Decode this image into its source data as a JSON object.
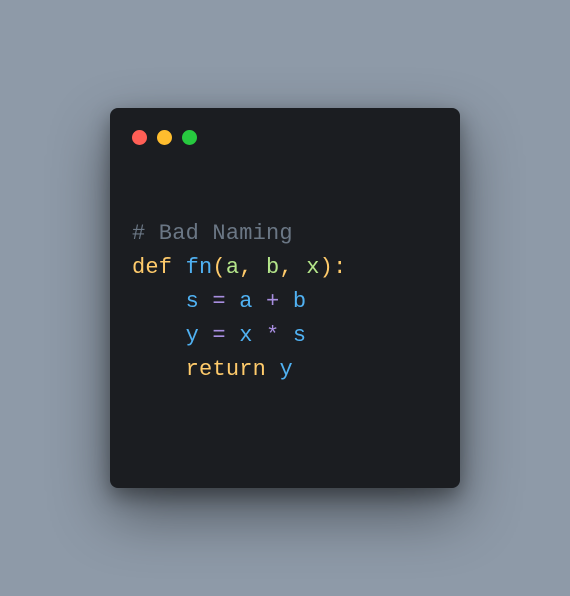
{
  "colors": {
    "red": "#ff5f56",
    "yellow": "#ffbd2e",
    "green": "#27c93f"
  },
  "code": {
    "line1": {
      "comment": "# Bad Naming"
    },
    "line2": {
      "kw_def": "def ",
      "fn": "fn",
      "lp": "(",
      "a": "a",
      "c1": ", ",
      "b": "b",
      "c2": ", ",
      "x": "x",
      "rp": ")",
      "colon": ":"
    },
    "line3": {
      "indent": "    ",
      "s": "s",
      "sp1": " ",
      "eq": "=",
      "sp2": " ",
      "a": "a",
      "sp3": " ",
      "plus": "+",
      "sp4": " ",
      "b": "b"
    },
    "line4": {
      "indent": "    ",
      "y": "y",
      "sp1": " ",
      "eq": "=",
      "sp2": " ",
      "x": "x",
      "sp3": " ",
      "star": "*",
      "sp4": " ",
      "s": "s"
    },
    "line5": {
      "indent": "    ",
      "kw_return": "return ",
      "y": "y"
    }
  }
}
